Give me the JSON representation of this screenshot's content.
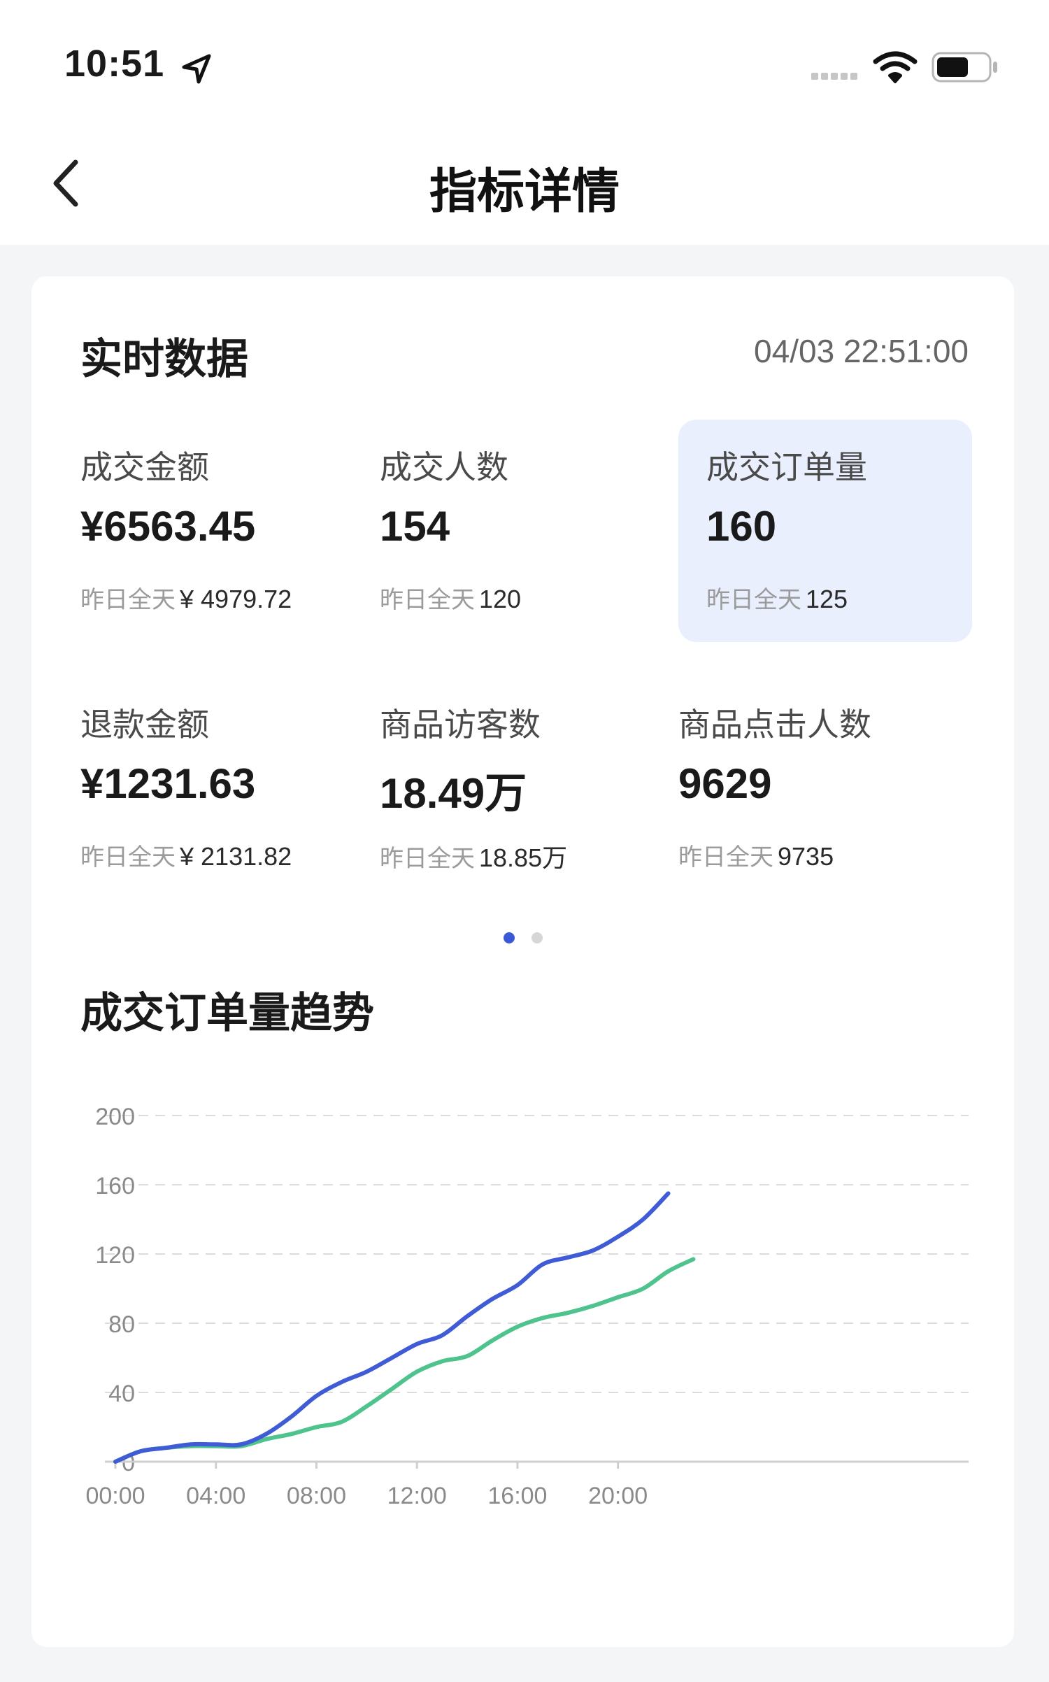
{
  "status_bar": {
    "time": "10:51",
    "icons": [
      "location-arrow-icon",
      "signal-icon",
      "wifi-icon",
      "battery-icon"
    ]
  },
  "nav": {
    "title": "指标详情",
    "back_icon": "chevron-left-icon"
  },
  "realtime": {
    "title": "实时数据",
    "timestamp": "04/03 22:51:00",
    "yesterday_label": "昨日全天",
    "metrics": [
      {
        "label": "成交金额",
        "value": "¥6563.45",
        "yesterday": "¥ 4979.72",
        "selected": false
      },
      {
        "label": "成交人数",
        "value": "154",
        "yesterday": "120",
        "selected": false
      },
      {
        "label": "成交订单量",
        "value": "160",
        "yesterday": "125",
        "selected": true
      },
      {
        "label": "退款金额",
        "value": "¥1231.63",
        "yesterday": "¥ 2131.82",
        "selected": false
      },
      {
        "label": "商品访客数",
        "value": "18.49万",
        "yesterday": "18.85万",
        "selected": false
      },
      {
        "label": "商品点击人数",
        "value": "9629",
        "yesterday": "9735",
        "selected": false
      }
    ],
    "pagination": {
      "pages": 2,
      "current": 1
    }
  },
  "trend": {
    "title": "成交订单量趋势"
  },
  "chart_data": {
    "type": "line",
    "title": "成交订单量趋势",
    "xlabel": "",
    "ylabel": "",
    "x_ticks": [
      "00:00",
      "04:00",
      "08:00",
      "12:00",
      "16:00",
      "20:00"
    ],
    "y_ticks": [
      0,
      40,
      80,
      120,
      160,
      200
    ],
    "xlim": [
      0,
      24
    ],
    "ylim": [
      0,
      200
    ],
    "grid": "horizontal-dashed",
    "x_unit": "hour",
    "series": [
      {
        "color": "#3f5bd6",
        "x": [
          0,
          1,
          2,
          3,
          4,
          5,
          6,
          7,
          8,
          9,
          10,
          11,
          12,
          13,
          14,
          15,
          16,
          17,
          18,
          19,
          20,
          21,
          22
        ],
        "values": [
          0,
          6,
          8,
          10,
          10,
          10,
          16,
          26,
          38,
          46,
          52,
          60,
          68,
          73,
          84,
          94,
          102,
          114,
          118,
          122,
          130,
          140,
          155
        ]
      },
      {
        "color": "#4ec38e",
        "x": [
          0,
          1,
          2,
          3,
          4,
          5,
          6,
          7,
          8,
          9,
          10,
          11,
          12,
          13,
          14,
          15,
          16,
          17,
          18,
          19,
          20,
          21,
          22,
          23
        ],
        "values": [
          0,
          6,
          8,
          9,
          9,
          9,
          13,
          16,
          20,
          23,
          32,
          42,
          52,
          58,
          61,
          70,
          78,
          83,
          86,
          90,
          95,
          100,
          110,
          117
        ]
      }
    ]
  }
}
